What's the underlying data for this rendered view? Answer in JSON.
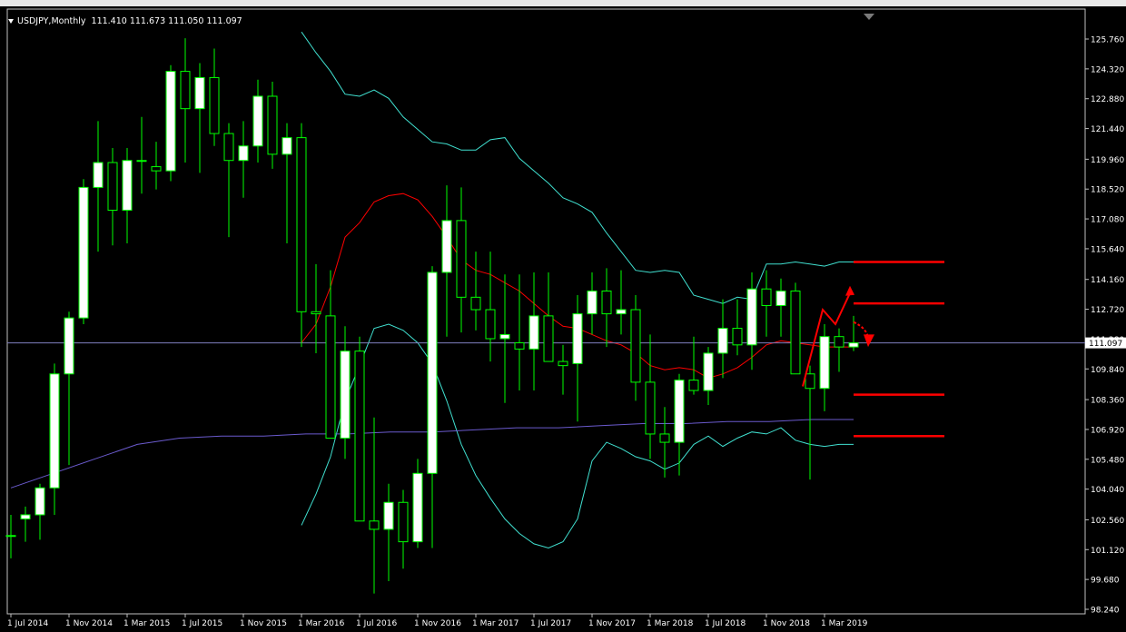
{
  "header": {
    "symbol": "USDJPY,Monthly",
    "ohlc": "111.410 111.673 111.050 111.097"
  },
  "price_labels": [
    "125.760",
    "124.320",
    "122.880",
    "121.440",
    "119.960",
    "118.520",
    "117.080",
    "115.640",
    "114.160",
    "112.720",
    "111.280",
    "109.840",
    "108.360",
    "106.920",
    "105.480",
    "104.040",
    "102.560",
    "101.120",
    "99.680",
    "98.240"
  ],
  "time_labels": [
    "1 Jul 2014",
    "1 Nov 2014",
    "1 Mar 2015",
    "1 Jul 2015",
    "1 Nov 2015",
    "1 Mar 2016",
    "1 Jul 2016",
    "1 Nov 2016",
    "1 Mar 2017",
    "1 Jul 2017",
    "1 Nov 2017",
    "1 Mar 2018",
    "1 Jul 2018",
    "1 Nov 2018",
    "1 Mar 2019"
  ],
  "current_price_label": "111.097",
  "colors": {
    "background": "#000000",
    "bull_candle": "#ffffff",
    "bear_candle": "#000000",
    "wick": "#00ff00",
    "bands": "#40e0d0",
    "ma_mid": "#ff0000",
    "ma_long": "#6a5acd",
    "annotation": "#ff0000",
    "bid_line": "#8080c0"
  },
  "chart_data": {
    "type": "candlestick",
    "symbol": "USDJPY",
    "timeframe": "Monthly",
    "x": [
      "2014-06",
      "2014-07",
      "2014-08",
      "2014-09",
      "2014-10",
      "2014-11",
      "2014-12",
      "2015-01",
      "2015-02",
      "2015-03",
      "2015-04",
      "2015-05",
      "2015-06",
      "2015-07",
      "2015-08",
      "2015-09",
      "2015-10",
      "2015-11",
      "2015-12",
      "2016-01",
      "2016-02",
      "2016-03",
      "2016-04",
      "2016-05",
      "2016-06",
      "2016-07",
      "2016-08",
      "2016-09",
      "2016-10",
      "2016-11",
      "2016-12",
      "2017-01",
      "2017-02",
      "2017-03",
      "2017-04",
      "2017-05",
      "2017-06",
      "2017-07",
      "2017-08",
      "2017-09",
      "2017-10",
      "2017-11",
      "2017-12",
      "2018-01",
      "2018-02",
      "2018-03",
      "2018-04",
      "2018-05",
      "2018-06",
      "2018-07",
      "2018-08",
      "2018-09",
      "2018-10",
      "2018-11",
      "2018-12",
      "2019-01",
      "2019-02",
      "2019-03",
      "2019-04"
    ],
    "open": [
      101.8,
      102.6,
      102.8,
      104.1,
      109.6,
      112.3,
      118.6,
      119.8,
      117.5,
      119.9,
      119.6,
      119.4,
      124.2,
      122.4,
      123.9,
      121.2,
      119.9,
      120.6,
      123.0,
      120.2,
      121.0,
      112.6,
      112.4,
      106.5,
      110.7,
      102.5,
      102.1,
      103.4,
      101.5,
      104.8,
      114.5,
      117.0,
      113.3,
      112.7,
      111.3,
      111.1,
      110.8,
      112.4,
      110.2,
      110.1,
      112.5,
      113.6,
      112.5,
      112.7,
      109.2,
      106.7,
      106.3,
      109.3,
      108.8,
      110.6,
      111.8,
      111.0,
      113.7,
      112.9,
      113.6,
      109.6,
      108.9,
      111.4,
      110.9
    ],
    "high": [
      102.8,
      103.2,
      104.3,
      110.1,
      112.6,
      119.0,
      121.8,
      120.5,
      120.5,
      122.0,
      120.8,
      124.5,
      125.8,
      124.6,
      125.3,
      121.7,
      121.8,
      123.8,
      123.7,
      121.7,
      121.7,
      114.9,
      114.6,
      111.9,
      111.4,
      107.5,
      104.3,
      104.0,
      105.5,
      114.8,
      118.7,
      118.6,
      115.5,
      115.5,
      114.4,
      114.4,
      114.5,
      114.5,
      111.0,
      113.4,
      114.5,
      114.7,
      114.6,
      113.4,
      111.5,
      108.0,
      109.6,
      111.4,
      110.9,
      113.2,
      113.2,
      114.5,
      114.6,
      114.2,
      114.0,
      110.0,
      112.0,
      111.8,
      112.4
    ],
    "low": [
      100.7,
      101.5,
      101.6,
      102.8,
      105.2,
      112.0,
      115.5,
      115.8,
      115.9,
      118.3,
      118.5,
      118.9,
      119.8,
      119.3,
      120.6,
      116.2,
      118.1,
      119.8,
      119.5,
      115.9,
      110.9,
      110.6,
      108.4,
      105.5,
      105.6,
      99.0,
      99.6,
      100.2,
      101.2,
      101.2,
      111.4,
      111.6,
      111.7,
      110.2,
      108.2,
      108.8,
      108.8,
      110.7,
      108.6,
      107.3,
      111.5,
      110.9,
      111.5,
      108.3,
      105.5,
      104.6,
      104.7,
      108.6,
      108.1,
      109.4,
      110.5,
      109.8,
      111.4,
      111.4,
      110.4,
      104.5,
      107.8,
      109.7,
      110.7
    ],
    "close": [
      101.8,
      102.8,
      104.1,
      109.6,
      112.3,
      118.6,
      119.8,
      117.5,
      119.9,
      119.9,
      119.4,
      124.2,
      122.4,
      123.9,
      121.2,
      119.9,
      120.6,
      123.0,
      120.2,
      121.0,
      112.6,
      112.5,
      106.5,
      110.7,
      102.5,
      102.1,
      103.4,
      101.5,
      104.8,
      114.5,
      117.0,
      113.3,
      112.7,
      111.3,
      111.5,
      110.8,
      112.4,
      110.2,
      110.0,
      112.5,
      113.6,
      112.5,
      112.7,
      109.2,
      106.7,
      106.3,
      109.3,
      108.8,
      110.6,
      111.8,
      111.0,
      113.7,
      112.9,
      113.6,
      109.6,
      108.9,
      111.4,
      110.9,
      111.097
    ],
    "indicators": {
      "bollinger_period_20": {
        "upper": [
          126.1,
          125.1,
          124.2,
          123.1,
          123.0,
          123.3,
          122.9,
          122.0,
          121.4,
          120.8,
          120.7,
          120.4,
          120.4,
          120.9,
          121.0,
          120.0,
          119.4,
          118.8,
          118.1,
          117.8,
          117.4,
          116.4,
          115.5,
          114.6,
          114.5,
          114.6,
          114.5,
          113.4,
          113.2,
          113.0,
          113.3,
          113.2,
          114.9,
          114.9,
          115.0,
          114.9,
          114.8,
          115.0,
          115.0
        ],
        "middle": [
          111.1,
          112.0,
          113.8,
          116.2,
          116.9,
          117.9,
          118.2,
          118.3,
          118.0,
          117.2,
          116.2,
          115.1,
          114.6,
          114.4,
          114.0,
          113.6,
          113.0,
          112.4,
          111.9,
          111.8,
          111.5,
          111.2,
          111.0,
          110.6,
          110.0,
          109.8,
          109.9,
          109.8,
          109.4,
          109.6,
          109.9,
          110.4,
          111.0,
          111.2,
          111.1,
          111.0,
          110.9,
          110.9,
          110.9
        ],
        "lower": [
          102.3,
          103.8,
          105.6,
          108.3,
          110.0,
          111.8,
          112.0,
          111.7,
          111.1,
          110.1,
          108.3,
          106.2,
          104.7,
          103.6,
          102.6,
          101.9,
          101.4,
          101.2,
          101.5,
          102.6,
          105.4,
          106.3,
          106.0,
          105.6,
          105.4,
          105.0,
          105.3,
          106.2,
          106.6,
          106.1,
          106.5,
          106.8,
          106.7,
          107.0,
          106.4,
          106.2,
          106.1,
          106.2,
          106.2
        ]
      },
      "moving_average_long": {
        "values": [
          104.1,
          104.8,
          105.5,
          106.2,
          106.5,
          106.6,
          106.6,
          106.7,
          106.7,
          106.8,
          106.8,
          106.9,
          107.0,
          107.0,
          107.1,
          107.2,
          107.2,
          107.3,
          107.3,
          107.4,
          107.4
        ]
      }
    },
    "annotations": {
      "horizontal_levels": [
        115.0,
        113.0,
        108.6,
        106.6
      ],
      "projected_path": [
        [
          109.0,
          112.7
        ],
        [
          112.0,
          111.6
        ],
        [
          110.9,
          113.5
        ]
      ]
    },
    "y_axis_range": [
      98.24,
      125.76
    ],
    "xlabel": "",
    "ylabel": "",
    "grid": false
  }
}
